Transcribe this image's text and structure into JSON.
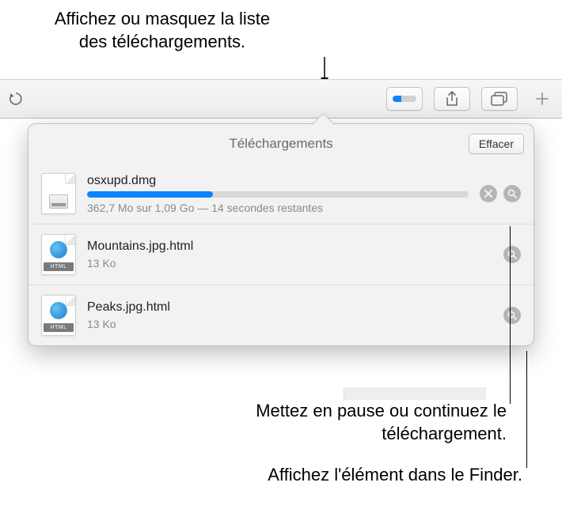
{
  "callouts": {
    "top": "Affichez ou masquez la liste des téléchargements.",
    "middle": "Mettez en pause ou continuez le téléchargement.",
    "bottom": "Affichez l'élément dans le Finder."
  },
  "popover": {
    "title": "Téléchargements",
    "clear_label": "Effacer"
  },
  "downloads": [
    {
      "name": "osxupd.dmg",
      "status": "362,7 Mo sur 1,09 Go — 14 secondes restantes",
      "progress_pct": 33,
      "in_progress": true,
      "type": "dmg"
    },
    {
      "name": "Mountains.jpg.html",
      "size": "13 Ko",
      "in_progress": false,
      "type": "html"
    },
    {
      "name": "Peaks.jpg.html",
      "size": "13 Ko",
      "in_progress": false,
      "type": "html"
    }
  ],
  "icons": {
    "html_label": "HTML"
  }
}
